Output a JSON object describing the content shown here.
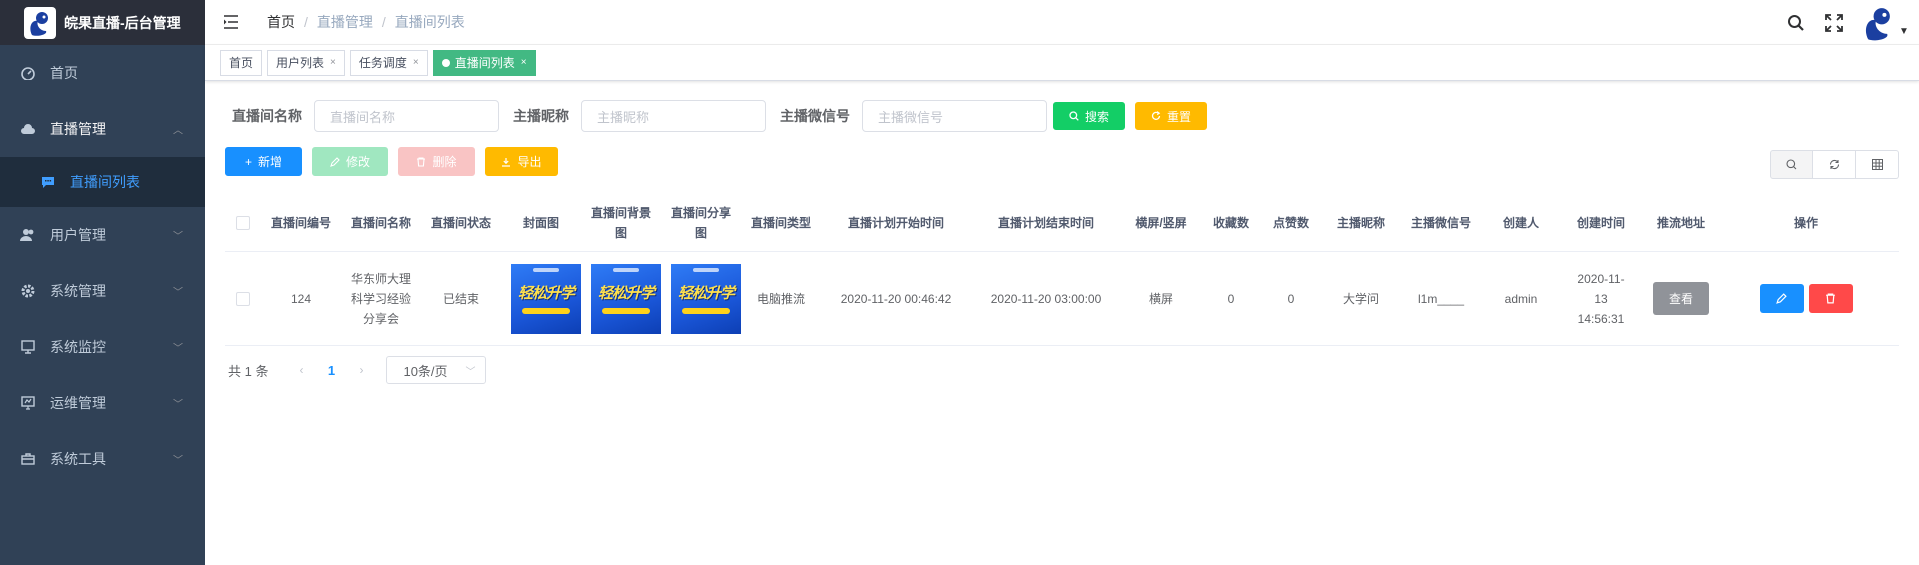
{
  "app": {
    "title": "皖果直播-后台管理"
  },
  "sidebar": {
    "items": [
      {
        "label": "首页",
        "icon": "dashboard-icon"
      },
      {
        "label": "直播管理",
        "icon": "cloud-icon",
        "open": true
      },
      {
        "label": "用户管理",
        "icon": "users-icon"
      },
      {
        "label": "系统管理",
        "icon": "gear-icon"
      },
      {
        "label": "系统监控",
        "icon": "monitor-icon"
      },
      {
        "label": "运维管理",
        "icon": "screen-icon"
      },
      {
        "label": "系统工具",
        "icon": "toolbox-icon"
      }
    ],
    "sub_item": {
      "label": "直播间列表",
      "icon": "chat-icon"
    }
  },
  "breadcrumb": [
    "首页",
    "直播管理",
    "直播间列表"
  ],
  "tags": [
    {
      "label": "首页"
    },
    {
      "label": "用户列表"
    },
    {
      "label": "任务调度"
    },
    {
      "label": "直播间列表",
      "active": true
    }
  ],
  "search": {
    "room_name_label": "直播间名称",
    "room_name_placeholder": "直播间名称",
    "nickname_label": "主播昵称",
    "nickname_placeholder": "主播昵称",
    "wechat_label": "主播微信号",
    "wechat_placeholder": "主播微信号",
    "search_btn": "搜索",
    "reset_btn": "重置"
  },
  "toolbar": {
    "add": "新增",
    "edit": "修改",
    "delete": "删除",
    "export": "导出"
  },
  "table": {
    "headers": [
      "直播间编号",
      "直播间名称",
      "直播间状态",
      "封面图",
      "直播间背景图",
      "直播间分享图",
      "直播间类型",
      "直播计划开始时间",
      "直播计划结束时间",
      "横屏/竖屏",
      "收藏数",
      "点赞数",
      "主播昵称",
      "主播微信号",
      "创建人",
      "创建时间",
      "推流地址",
      "操作"
    ],
    "rows": [
      {
        "id": "124",
        "name": "华东师大理科学习经验分享会",
        "status": "已结束",
        "thumb_text": "轻松升学",
        "type": "电脑推流",
        "start": "2020-11-20 00:46:42",
        "end": "2020-11-20 03:00:00",
        "orientation": "横屏",
        "favorites": "0",
        "likes": "0",
        "nickname": "大学问",
        "wechat": "l1m____",
        "creator": "admin",
        "created": "2020-11-13 14:56:31",
        "view_btn": "查看"
      }
    ]
  },
  "pagination": {
    "total": "共 1 条",
    "current": "1",
    "page_size": "10条/页"
  },
  "colors": {
    "sidebar_bg": "#304156",
    "primary": "#1890ff",
    "active_tag": "#42b983"
  }
}
